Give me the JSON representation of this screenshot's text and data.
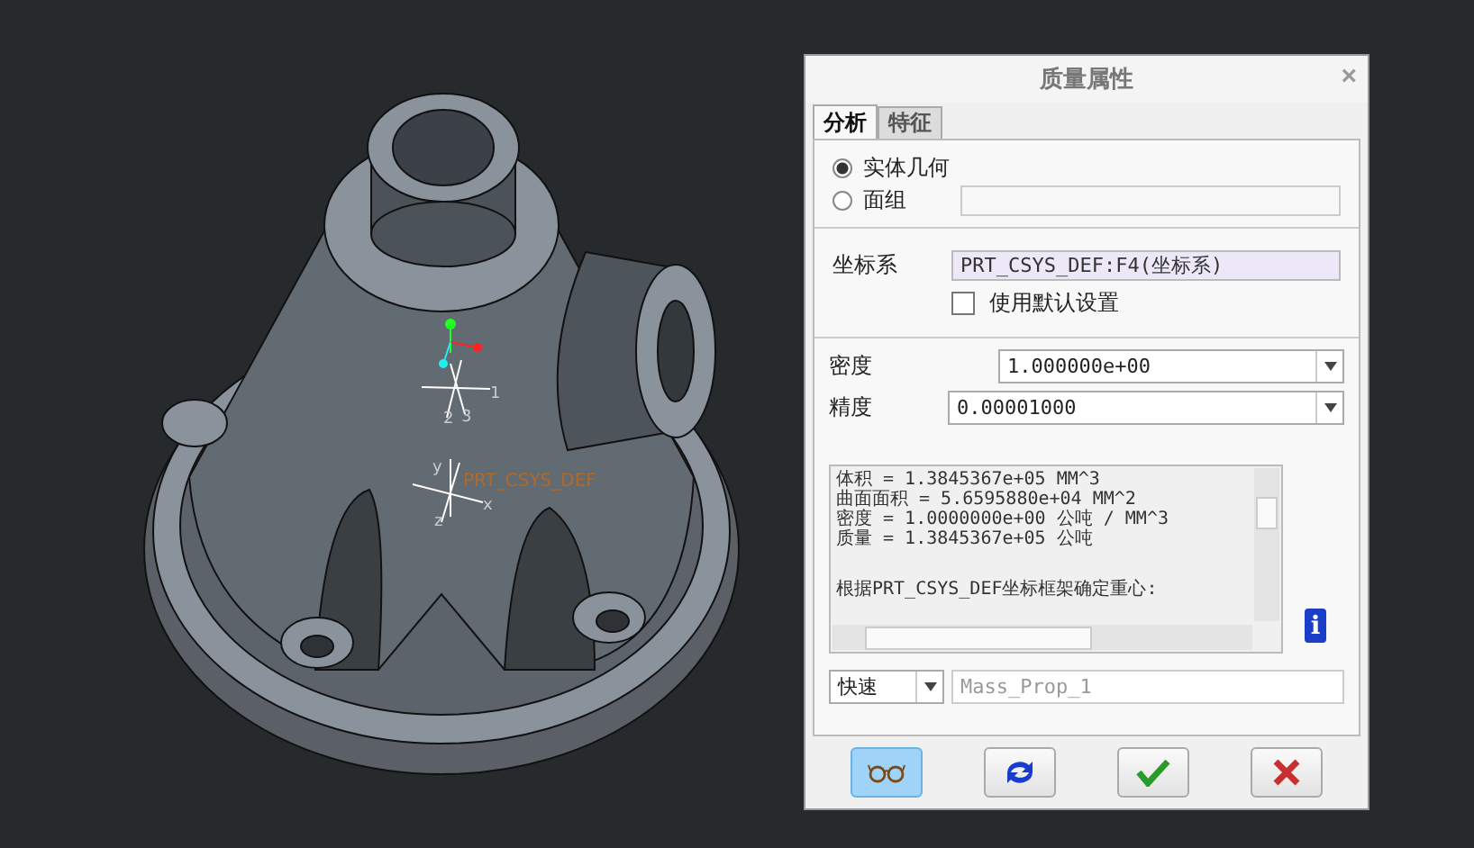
{
  "viewport": {
    "csys_label": "PRT_CSYS_DEF",
    "axis_labels": [
      "1",
      "2",
      "3"
    ],
    "csys_axis_labels": [
      "x",
      "y",
      "z"
    ]
  },
  "dialog": {
    "title": "质量属性",
    "close": "×",
    "tabs": [
      {
        "label": "分析",
        "selected": true
      },
      {
        "label": "特征",
        "selected": false
      }
    ],
    "geometry": [
      {
        "label": "实体几何",
        "selected": true
      },
      {
        "label": "面组",
        "selected": false
      }
    ],
    "coordinate_system": {
      "label": "坐标系",
      "value": "PRT_CSYS_DEF:F4(坐标系)",
      "use_default": {
        "label": "使用默认设置",
        "checked": false
      }
    },
    "density": {
      "label": "密度",
      "value": "1.000000e+00"
    },
    "accuracy": {
      "label": "精度",
      "value": "0.00001000"
    },
    "results": [
      "体积 =  1.3845367e+05  MM^3",
      "曲面面积 =  5.6595880e+04  MM^2",
      "密度 =  1.0000000e+00 公吨 / MM^3",
      "质量 =  1.3845367e+05 公吨",
      "根据PRT_CSYS_DEF坐标框架确定重心:"
    ],
    "info": "i",
    "mode": "快速",
    "name": "Mass_Prop_1",
    "buttons": [
      {
        "kind": "preview",
        "selected": true
      },
      {
        "kind": "recompute",
        "selected": false
      },
      {
        "kind": "ok",
        "selected": false
      },
      {
        "kind": "cancel",
        "selected": false
      }
    ]
  }
}
